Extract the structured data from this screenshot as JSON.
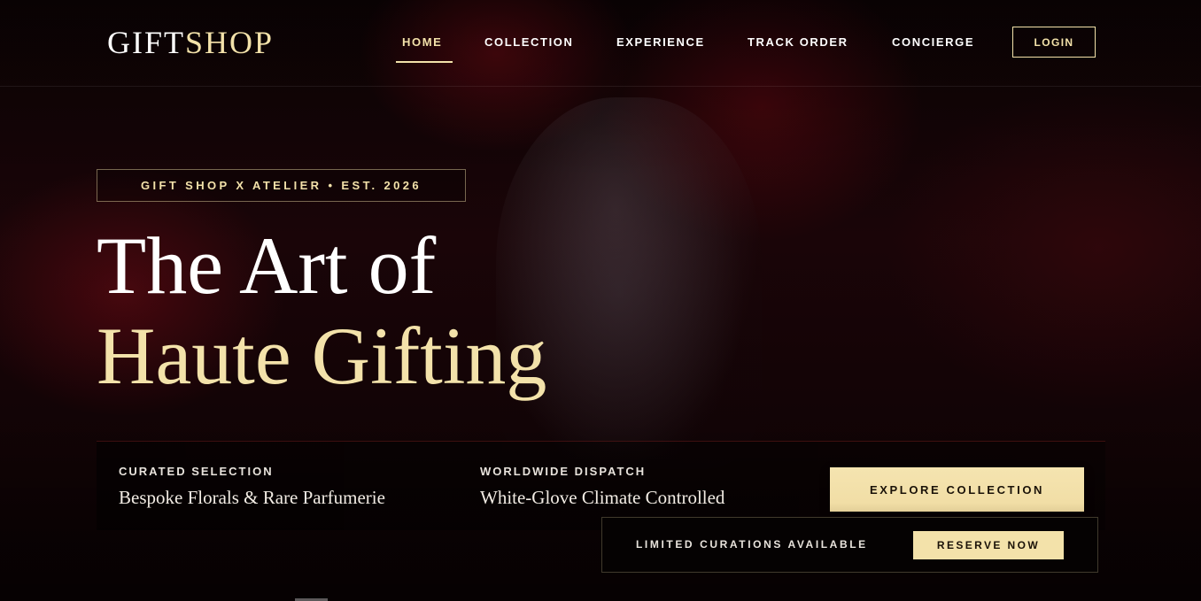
{
  "brand": {
    "logo_primary": "GIFT",
    "logo_accent": "SHOP"
  },
  "nav": {
    "items": [
      {
        "label": "HOME",
        "active": true
      },
      {
        "label": "COLLECTION",
        "active": false
      },
      {
        "label": "EXPERIENCE",
        "active": false
      },
      {
        "label": "TRACK ORDER",
        "active": false
      },
      {
        "label": "CONCIERGE",
        "active": false
      }
    ],
    "login_label": "LOGIN"
  },
  "hero": {
    "tagline": "GIFT SHOP X ATELIER • EST. 2026",
    "headline_line1": "The Art of",
    "headline_line2": "Haute Gifting"
  },
  "info": {
    "items": [
      {
        "label": "CURATED SELECTION",
        "value": "Bespoke Florals & Rare Parfumerie"
      },
      {
        "label": "WORLDWIDE DISPATCH",
        "value": "White-Glove Climate Controlled"
      }
    ],
    "cta_label": "EXPLORE COLLECTION"
  },
  "reservation": {
    "text": "LIMITED CURATIONS AVAILABLE",
    "button_label": "RESERVE NOW"
  },
  "colors": {
    "accent": "#f3e2aa",
    "background": "#070203",
    "text": "#ffffff"
  }
}
